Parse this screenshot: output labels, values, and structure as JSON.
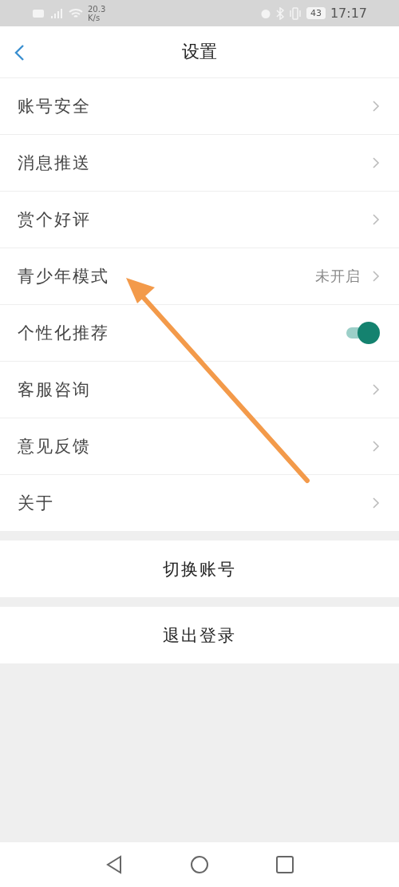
{
  "status_bar": {
    "speed": "20.3",
    "speed_unit": "K/s",
    "battery": "43",
    "time": "17:17"
  },
  "header": {
    "title": "设置"
  },
  "settings": [
    {
      "kind": "link",
      "label": "账号安全"
    },
    {
      "kind": "link",
      "label": "消息推送"
    },
    {
      "kind": "link",
      "label": "赏个好评"
    },
    {
      "kind": "link",
      "label": "青少年模式",
      "value": "未开启"
    },
    {
      "kind": "toggle",
      "label": "个性化推荐",
      "on": true
    },
    {
      "kind": "link",
      "label": "客服咨询"
    },
    {
      "kind": "link",
      "label": "意见反馈"
    },
    {
      "kind": "link",
      "label": "关于"
    }
  ],
  "actions": [
    "切换账号",
    "退出登录"
  ]
}
